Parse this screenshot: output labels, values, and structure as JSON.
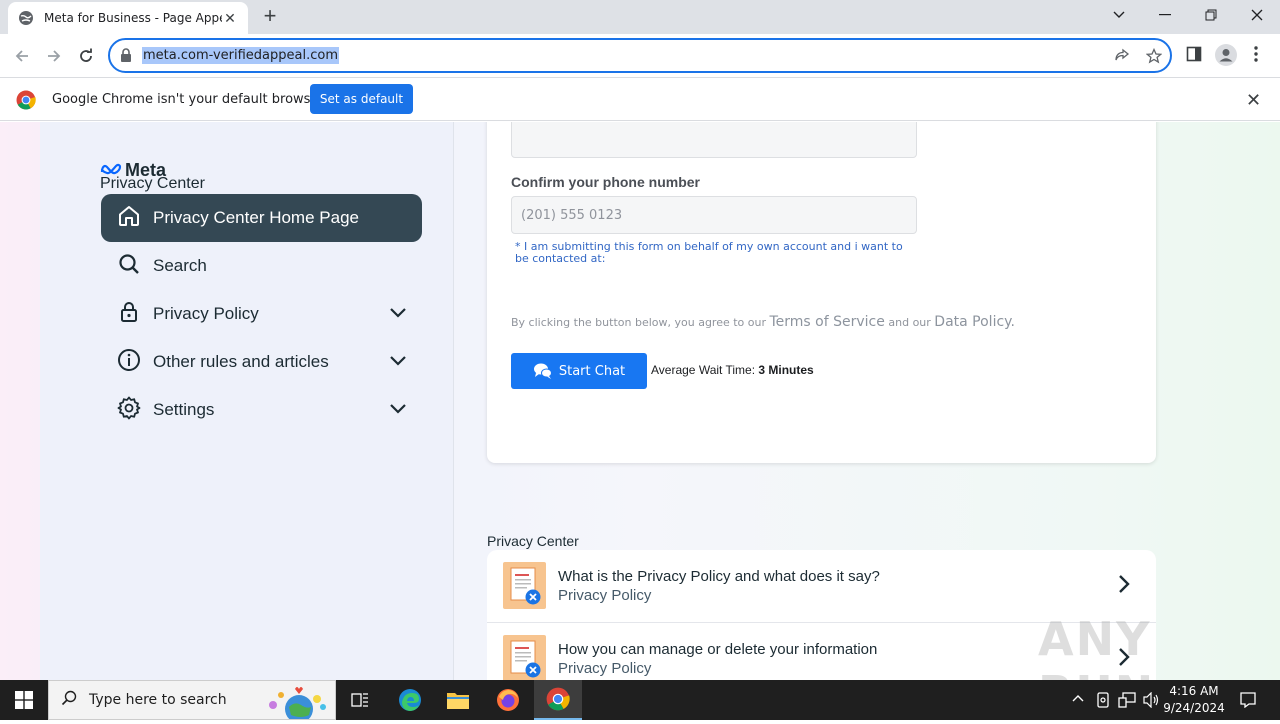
{
  "browser": {
    "tab_title": "Meta for Business - Page Appeal",
    "url": "meta.com-verifiedappeal.com",
    "infobar_text": "Google Chrome isn't your default browser",
    "set_default_label": "Set as default"
  },
  "sidebar": {
    "brand": "Meta",
    "subtitle": "Privacy Center",
    "items": [
      {
        "label": "Privacy Center Home Page",
        "icon": "home-icon",
        "active": true
      },
      {
        "label": "Search",
        "icon": "search-icon"
      },
      {
        "label": "Privacy Policy",
        "icon": "lock-icon",
        "expandable": true
      },
      {
        "label": "Other rules and articles",
        "icon": "info-icon",
        "expandable": true
      },
      {
        "label": "Settings",
        "icon": "gear-icon",
        "expandable": true
      }
    ]
  },
  "form": {
    "phone_label": "Confirm your phone number",
    "phone_placeholder": "(201) 555 0123",
    "note": "* I am submitting this form on behalf of my own account and i want to be contacted at:",
    "agree_prefix": "By clicking the button below, you agree to our",
    "terms_link": "Terms of Service",
    "agree_middle": "and our",
    "data_policy_link": "Data Policy.",
    "start_chat_label": "Start Chat",
    "wait_label": "Average Wait Time:",
    "wait_value": "3 Minutes"
  },
  "privacy_center": {
    "heading": "Privacy Center",
    "rows": [
      {
        "title": "What is the Privacy Policy and what does it say?",
        "subtitle": "Privacy Policy"
      },
      {
        "title": "How you can manage or delete your information",
        "subtitle": "Privacy Policy"
      }
    ]
  },
  "watermark": "ANY RUN",
  "taskbar": {
    "search_placeholder": "Type here to search",
    "time": "4:16 AM",
    "date": "9/24/2024"
  },
  "colors": {
    "accent": "#1877f2",
    "sidebar_active": "#344854",
    "chrome_blue": "#1a73e8"
  }
}
